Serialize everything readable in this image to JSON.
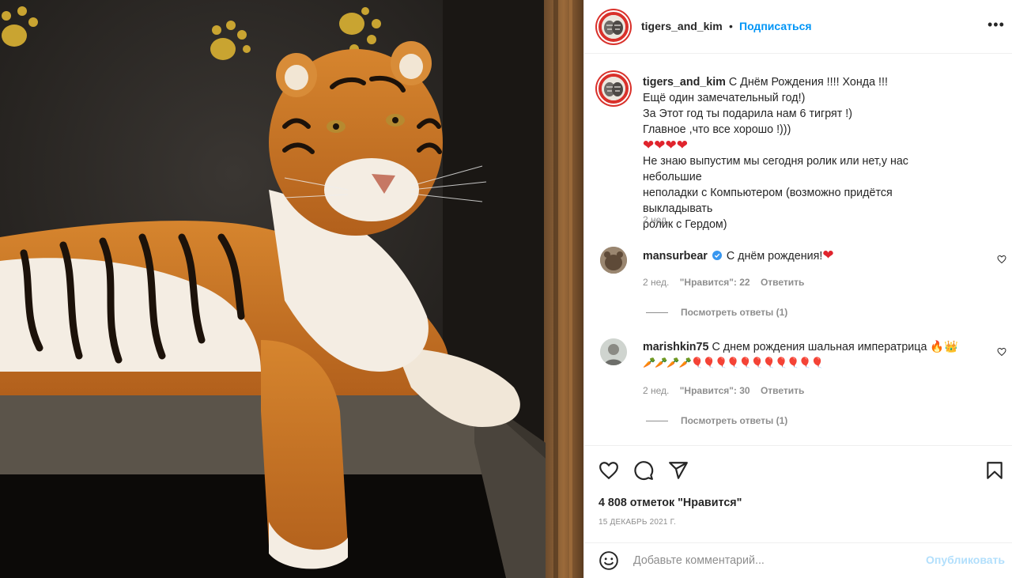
{
  "post": {
    "author": "tigers_and_kim",
    "follow_label": "Подписаться",
    "more_label": "•••",
    "separator": "•"
  },
  "caption": {
    "author": "tigers_and_kim",
    "lines": [
      "С Днём Рождения !!!! Хонда !!!",
      "Ещё один замечательный год!)",
      "За Этот год ты подарила нам 6 тигрят !)",
      "Главное ,что все хорошо !)))",
      "❤❤❤❤",
      "Не знаю выпустим мы сегодня ролик или нет,у нас небольшие",
      "неполадки с Компьютером (возможно придётся выкладывать",
      "ролик с Гердом)"
    ],
    "time": "2 нед."
  },
  "comments": [
    {
      "user": "mansurbear",
      "verified": true,
      "text": "С днём рождения!",
      "text_suffix": "❤",
      "time": "2 нед.",
      "likes_label": "\"Нравится\": 22",
      "reply_label": "Ответить",
      "replies_label": "Посмотреть ответы (1)"
    },
    {
      "user": "marishkin75",
      "verified": false,
      "text": "С днем рождения шальная императрица 🔥👑",
      "emoji_line": "🥕🥕🥕🥕🎈🎈🎈🎈🎈🎈🎈🎈🎈🎈🎈",
      "time": "2 нед.",
      "likes_label": "\"Нравится\": 30",
      "reply_label": "Ответить",
      "replies_label": "Посмотреть ответы (1)"
    }
  ],
  "stats": {
    "likes": "4 808 отметок \"Нравится\"",
    "date": "15 ДЕКАБРЬ 2021 Г."
  },
  "comment_box": {
    "placeholder": "Добавьте комментарий...",
    "publish_label": "Опубликовать"
  },
  "colors": {
    "accent": "#0095f6",
    "publish_disabled": "#b2dffc",
    "secondary_text": "#8e8e8e",
    "heart_red": "#e0242d",
    "avatar_ring": "#d9312b"
  },
  "icons": [
    "heart-icon",
    "comment-icon",
    "share-icon",
    "bookmark-icon",
    "emoji-icon",
    "verified-icon",
    "more-icon"
  ]
}
